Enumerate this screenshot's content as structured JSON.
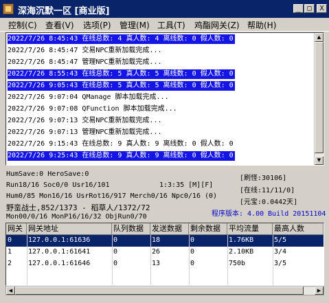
{
  "window": {
    "title": "深海沉默一区 [商业版]",
    "controls": {
      "minimize": "_",
      "maximize": "□",
      "close": "X"
    }
  },
  "menu": [
    {
      "label": "控制(C)"
    },
    {
      "label": "查看(V)"
    },
    {
      "label": "选项(P)"
    },
    {
      "label": "管理(M)"
    },
    {
      "label": "工具(T)"
    },
    {
      "label": "鸡酯网关(Z)"
    },
    {
      "label": "帮助(H)"
    }
  ],
  "log": [
    {
      "text": "2022/7/26 8:45:43 在线总数: 4 真人数: 4 离线数: 0 假人数: 0",
      "highlight": true
    },
    {
      "text": "2022/7/26 8:45:47 交易NPC重新加载完成...",
      "highlight": false
    },
    {
      "text": "2022/7/26 8:45:47 管理NPC重新加载完成...",
      "highlight": false
    },
    {
      "text": "2022/7/26 8:55:43 在线总数: 5 真人数: 5 离线数: 0 假人数: 0",
      "highlight": true
    },
    {
      "text": "2022/7/26 9:05:43 在线总数: 5 真人数: 5 离线数: 0 假人数: 0",
      "highlight": true
    },
    {
      "text": "2022/7/26 9:07:04 QManage 脚本加载完成...",
      "highlight": false
    },
    {
      "text": "2022/7/26 9:07:08 QFunction 脚本加载完成...",
      "highlight": false
    },
    {
      "text": "2022/7/26 9:07:13 交易NPC重新加载完成...",
      "highlight": false
    },
    {
      "text": "2022/7/26 9:07:13 管理NPC重新加载完成...",
      "highlight": false
    },
    {
      "text": "2022/7/26 9:15:43 在线总数: 9 真人数: 9 离线数: 0 假人数: 0",
      "highlight": false
    },
    {
      "text": "2022/7/26 9:25:43 在线总数: 9 真人数: 9 离线数: 0 假人数: 0",
      "highlight": true
    }
  ],
  "status": {
    "line1": "HumSave:0 HeroSave:0",
    "line2": "Run18/16 Soc0/0 Usr16/101",
    "time": "1:3:35 [M][F]",
    "line3": "Hum0/85 Mon16/16 UsrRot16/917 Merch0/16 Npc0/16 (0)",
    "line4": "野蛮战士,852/1373 - 稻草人/1372/72",
    "line5": "Mon00/0/16 MonP16/16/32 ObjRun0/70",
    "monsters": "[刷怪:30106]",
    "online": "[在线:11/11/0]",
    "yuanbao": "[元宝:0.0442天]",
    "version": "程序版本: 4.00 Build 20151104"
  },
  "table": {
    "columns": [
      "网关",
      "网关地址",
      "队列数据",
      "发送数据",
      "剩余数据",
      "平均流量",
      "最高人数"
    ],
    "rows": [
      {
        "cells": [
          "0",
          "127.0.0.1:61636",
          "0",
          "18",
          "0",
          "1.76KB",
          "5/5"
        ],
        "selected": true
      },
      {
        "cells": [
          "1",
          "127.0.0.1:61641",
          "0",
          "26",
          "0",
          "2.10KB",
          "3/4"
        ],
        "selected": false
      },
      {
        "cells": [
          "2",
          "127.0.0.1:61646",
          "0",
          "13",
          "0",
          "750b",
          "3/5"
        ],
        "selected": false
      }
    ]
  },
  "colors": {
    "titlebar": "#0a246a",
    "highlight": "#1515e6",
    "selection": "#0a246a",
    "version_text": "#0000cc"
  }
}
